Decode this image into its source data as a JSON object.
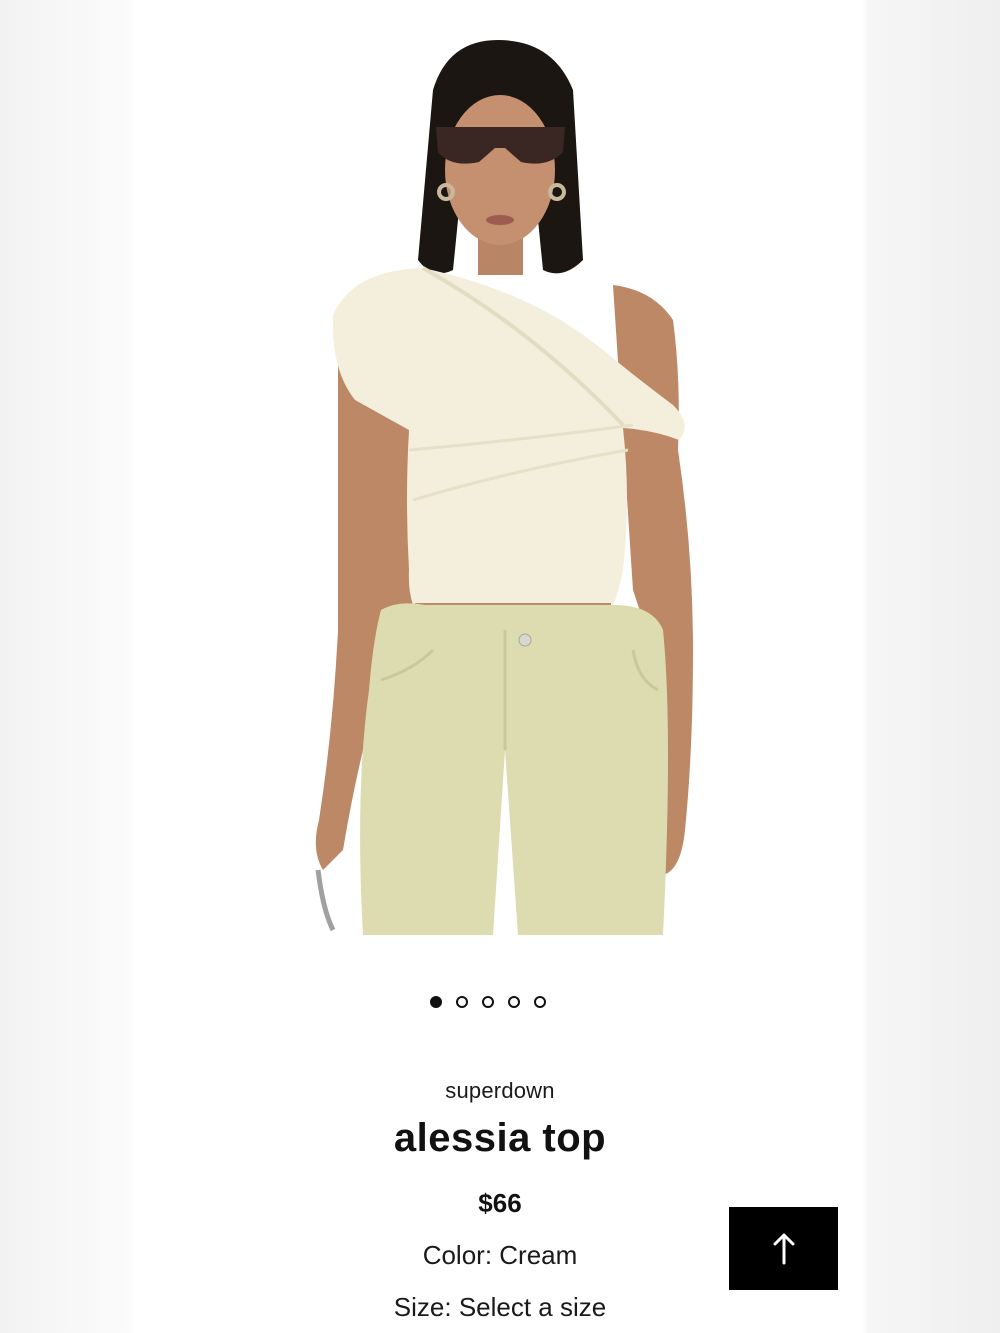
{
  "product": {
    "brand": "superdown",
    "name": "alessia top",
    "price": "$66",
    "color_label": "Color:",
    "color_value": "Cream",
    "size_label": "Size:",
    "size_value": "Select a size"
  },
  "carousel": {
    "total": 5,
    "active_index": 0
  },
  "icons": {
    "favorite": "heart-outline-icon",
    "scroll_top": "arrow-up-icon"
  },
  "colors": {
    "favorite_heart": "#1e73e8",
    "scroll_button_bg": "#000000",
    "text": "#111111"
  }
}
